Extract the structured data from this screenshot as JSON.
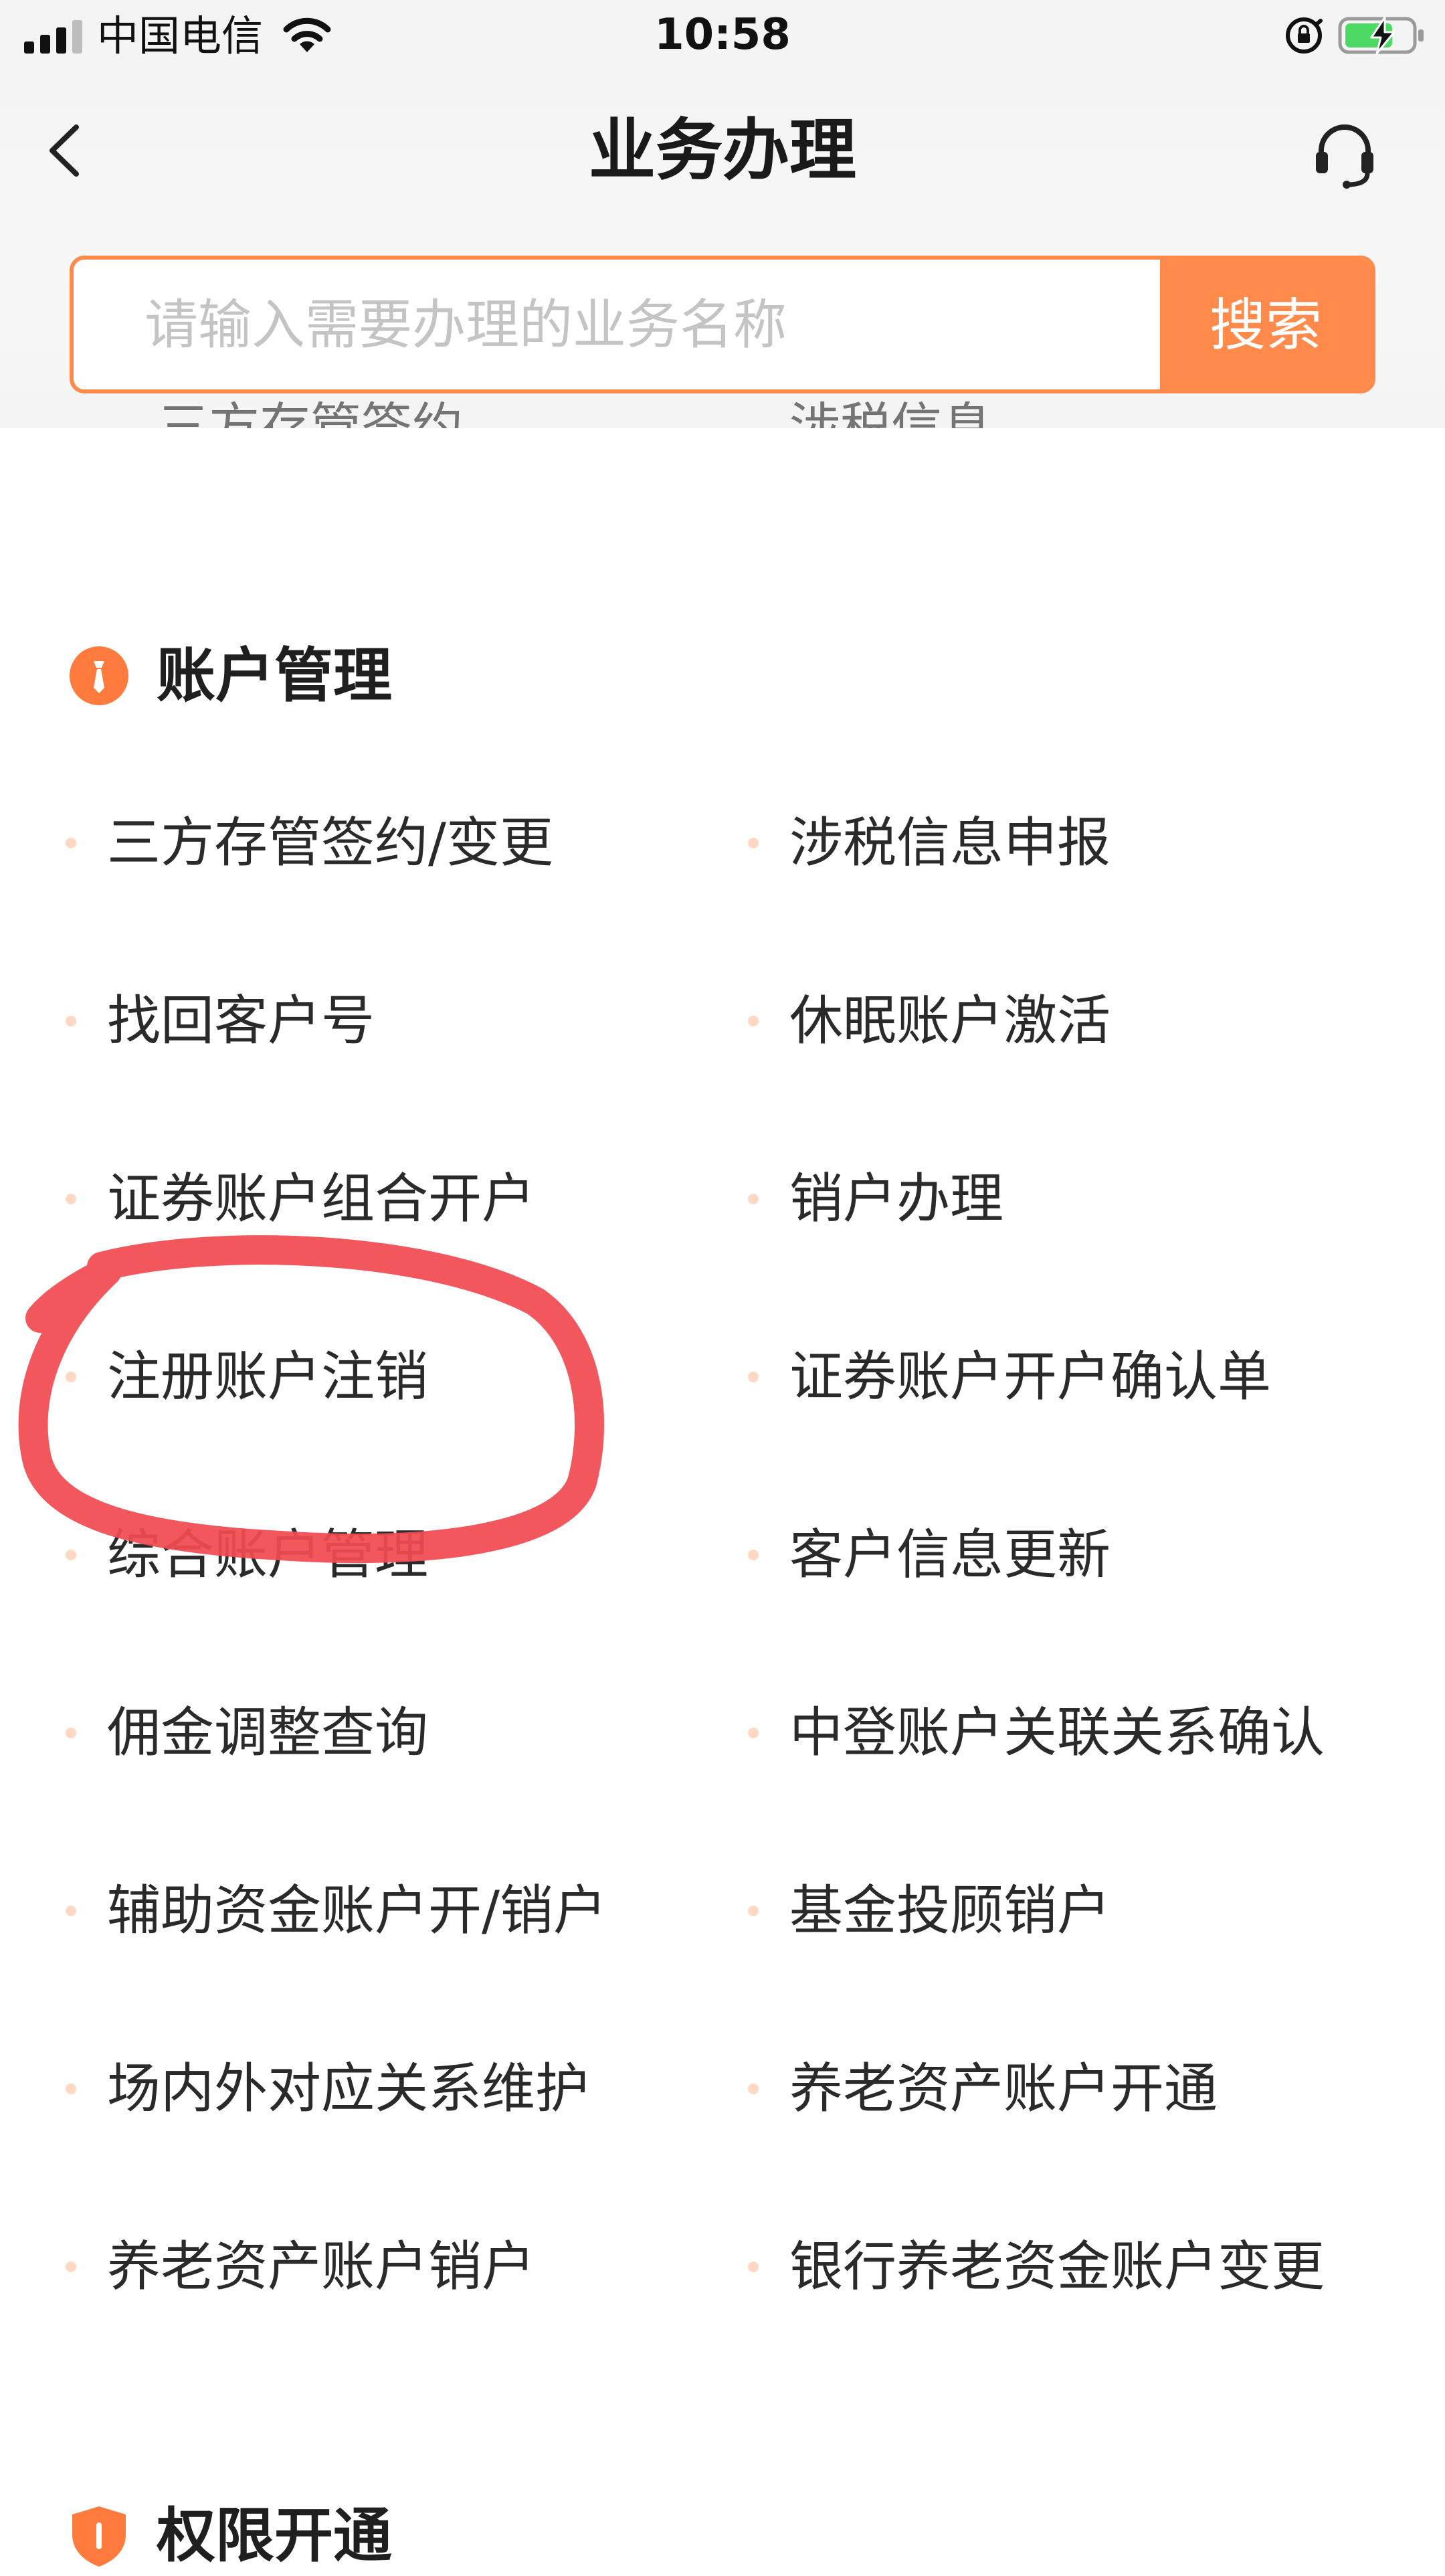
{
  "status_bar": {
    "carrier": "中国电信",
    "time": "10:58"
  },
  "nav": {
    "title": "业务办理"
  },
  "search": {
    "placeholder": "请输入需要办理的业务名称",
    "button_label": "搜索"
  },
  "sections": [
    {
      "title": "账户管理",
      "items": [
        "三方存管签约/变更",
        "涉税信息申报",
        "找回客户号",
        "休眠账户激活",
        "证券账户组合开户",
        "销户办理",
        "注册账户注销",
        "证券账户开户确认单",
        "综合账户管理",
        "客户信息更新",
        "佣金调整查询",
        "中登账户关联关系确认",
        "辅助资金账户开/销户",
        "基金投顾销户",
        "场内外对应关系维护",
        "养老资产账户开通",
        "养老资产账户销户",
        "银行养老资金账户变更"
      ]
    },
    {
      "title": "权限开通",
      "items": []
    }
  ],
  "colors": {
    "accent": "#ff8a4c",
    "dot": "#ffd8c4",
    "section_icon": "#ff7a3d",
    "annotation": "#f24a52"
  },
  "icons": {
    "back": "chevron-left-icon",
    "service": "headset-icon",
    "account_section": "account-badge-icon",
    "permission_section": "shield-icon"
  }
}
